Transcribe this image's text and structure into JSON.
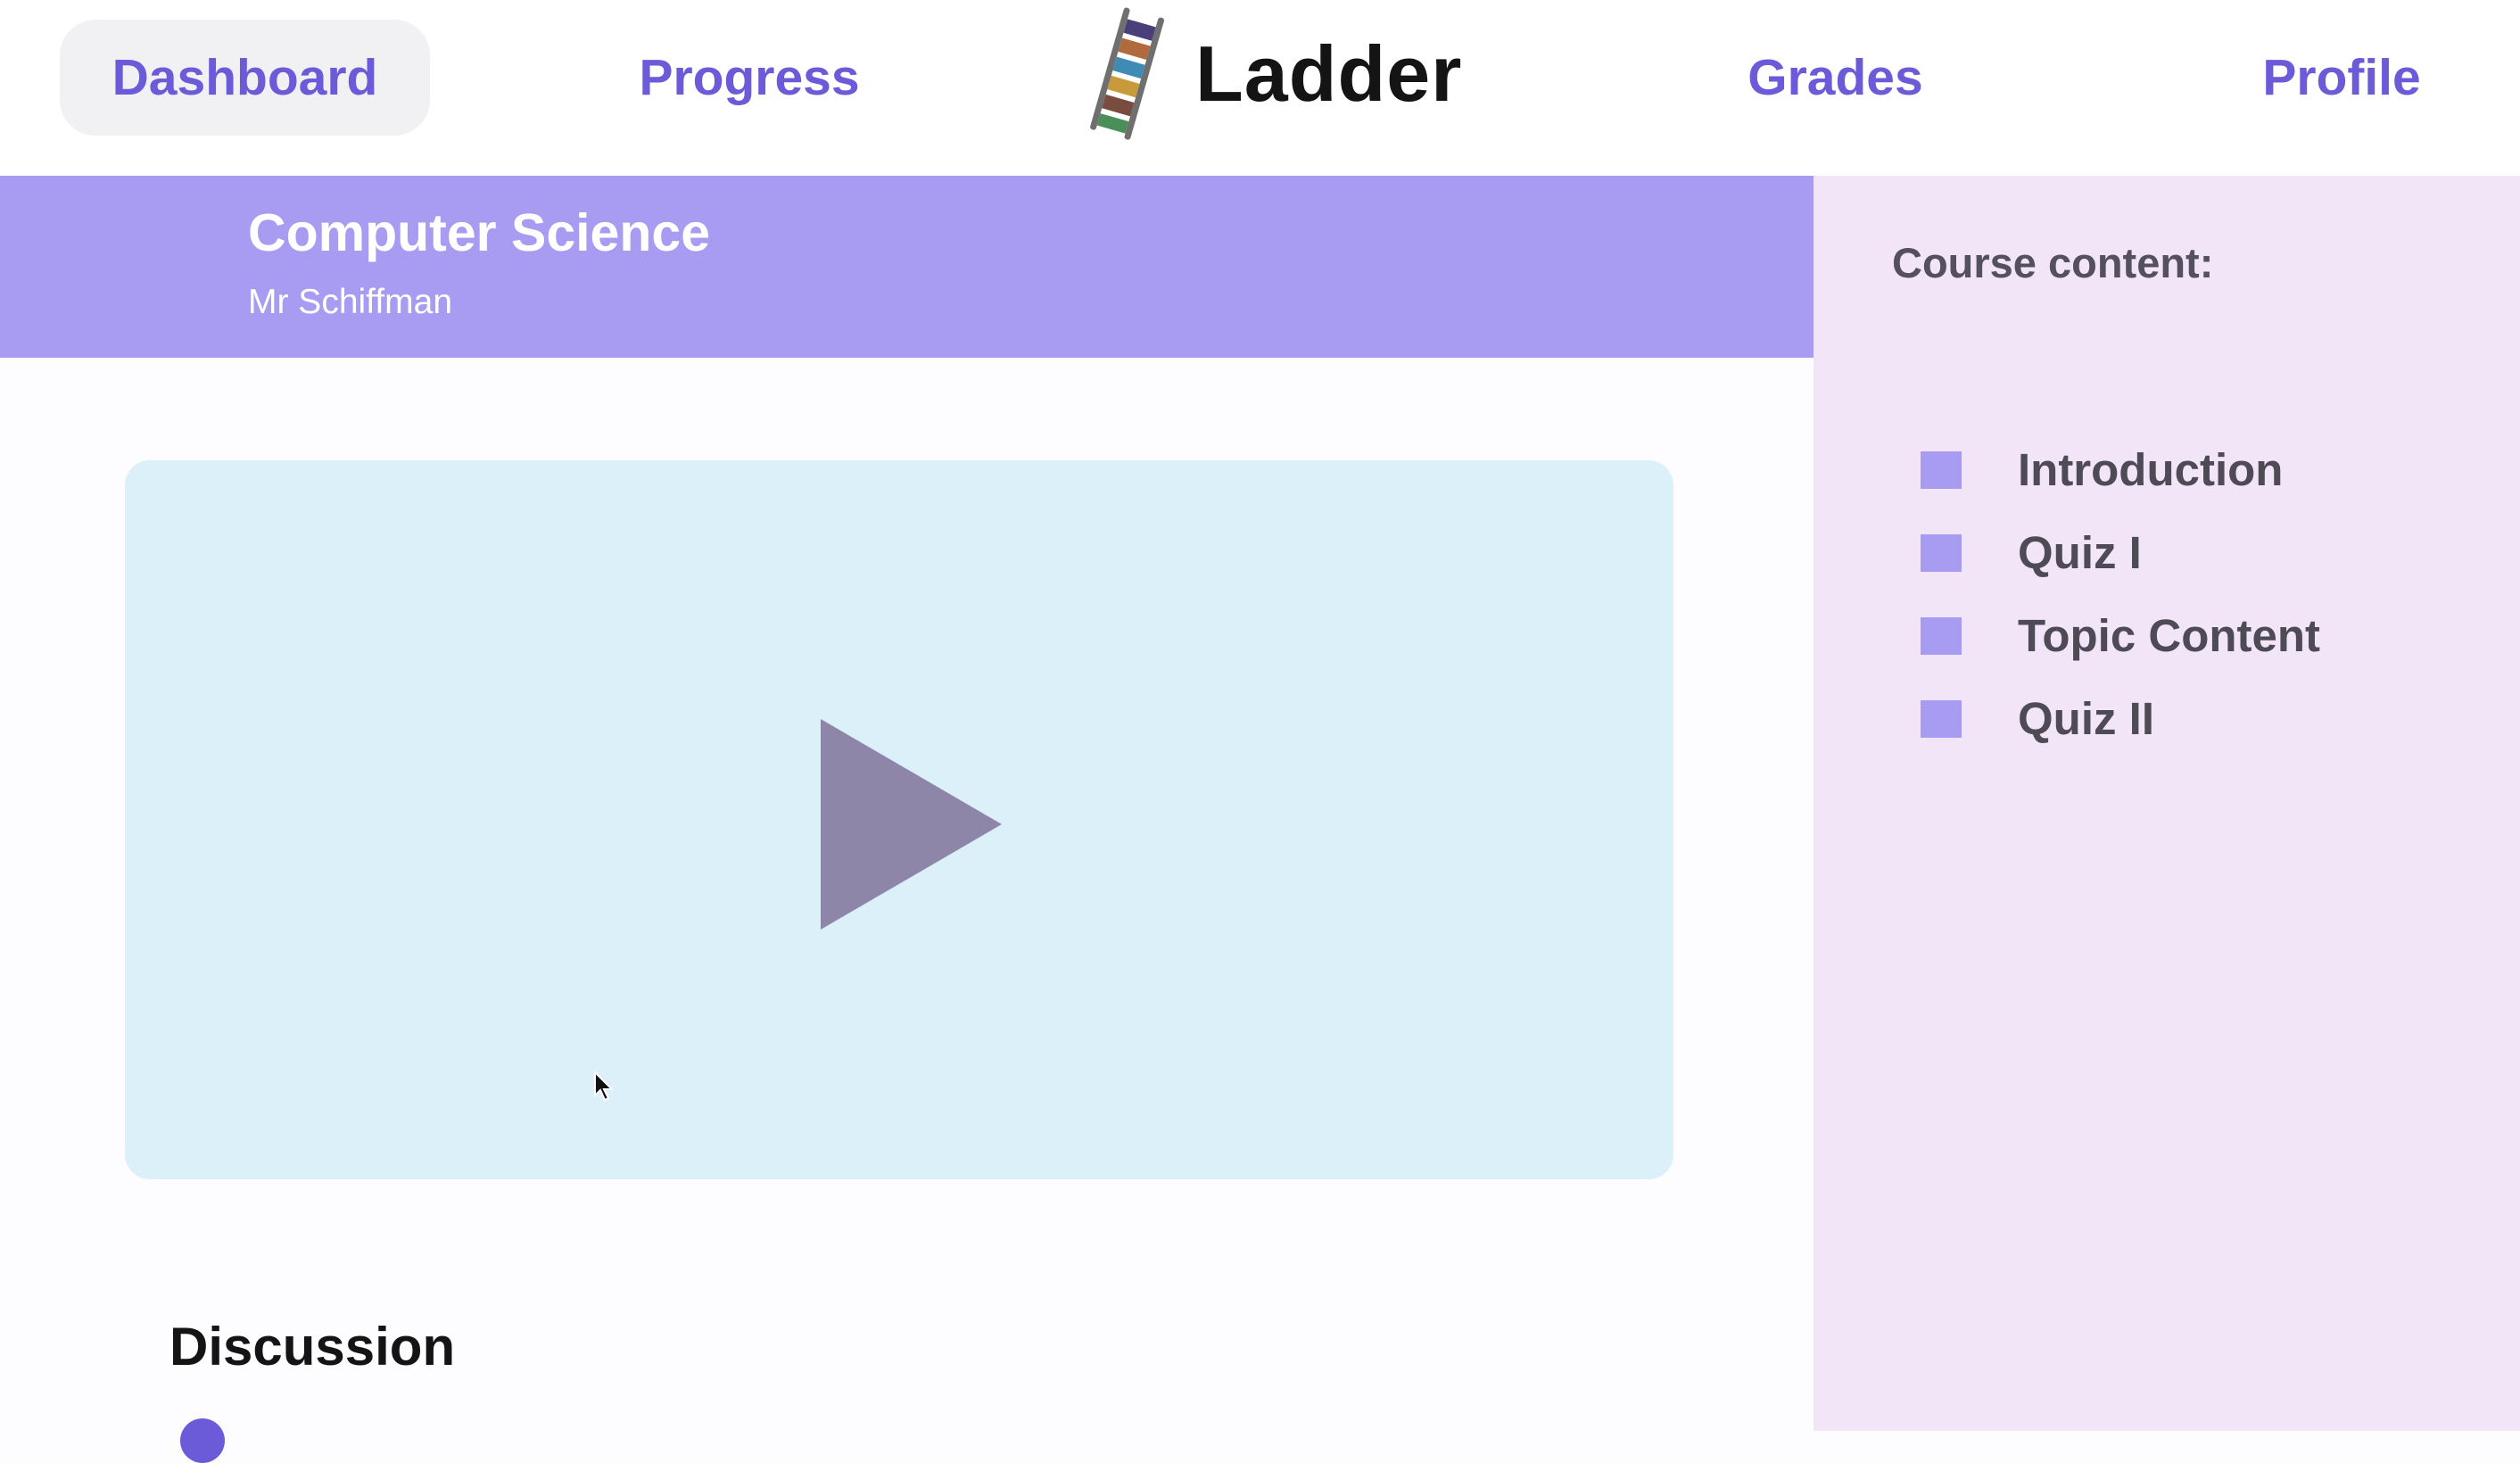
{
  "nav": {
    "dashboard": "Dashboard",
    "progress": "Progress",
    "grades": "Grades",
    "profile": "Profile",
    "active": "Dashboard"
  },
  "brand": {
    "name": "Ladder",
    "icon": "ladder-logo-icon"
  },
  "course": {
    "title": "Computer Science",
    "teacher": "Mr Schiffman"
  },
  "sidebar": {
    "heading": "Course content:",
    "items": [
      {
        "label": "Introduction"
      },
      {
        "label": "Quiz I"
      },
      {
        "label": "Topic Content"
      },
      {
        "label": "Quiz II"
      }
    ]
  },
  "video": {
    "icon": "play-icon"
  },
  "discussion": {
    "title": "Discussion"
  },
  "colors": {
    "accent": "#6b5bd8",
    "header": "#a79cf2",
    "sidebar_bg": "#f1e5f7",
    "video_bg": "#dbf0f9",
    "play": "#8e86a8"
  }
}
